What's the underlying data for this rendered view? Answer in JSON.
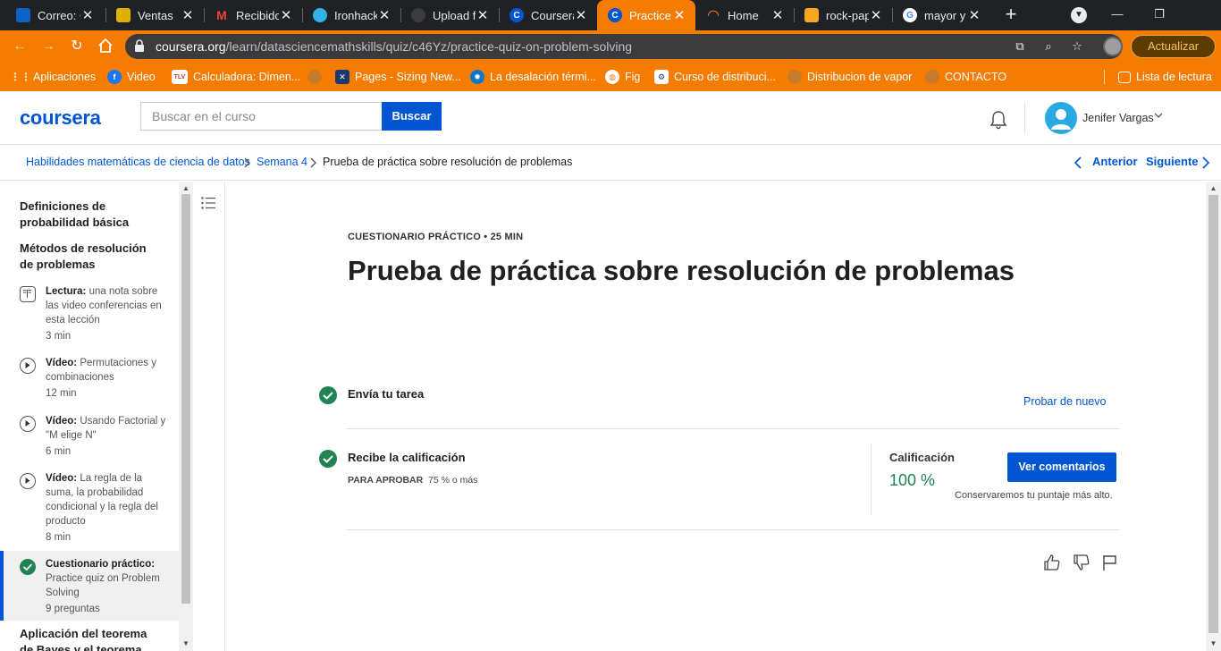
{
  "browser": {
    "tabs": [
      {
        "title": "Correo: C",
        "favicon_color": "#0a64c8",
        "favicon_glyph": "O"
      },
      {
        "title": "Ventas",
        "favicon_color": "#e0b000",
        "favicon_glyph": "V"
      },
      {
        "title": "Recibido",
        "favicon_color": "#ffffff",
        "favicon_glyph": "M"
      },
      {
        "title": "Ironhack",
        "favicon_color": "#32b2e6",
        "favicon_glyph": "I"
      },
      {
        "title": "Upload f",
        "favicon_color": "#3c3c3c",
        "favicon_glyph": "G"
      },
      {
        "title": "Coursera",
        "favicon_color": "#0056d2",
        "favicon_glyph": "C"
      },
      {
        "title": "Practice",
        "favicon_color": "#0056d2",
        "favicon_glyph": "C"
      },
      {
        "title": "Home",
        "favicon_color": "#202124",
        "favicon_glyph": "◠"
      },
      {
        "title": "rock-pap",
        "favicon_color": "#f5a623",
        "favicon_glyph": "▮"
      },
      {
        "title": "mayor y",
        "favicon_color": "#ffffff",
        "favicon_glyph": "G"
      }
    ],
    "url_host": "coursera.org",
    "url_path": "/learn/datasciencemathskills/quiz/c46Yz/practice-quiz-on-problem-solving",
    "update_label": "Actualizar",
    "bookmarks": [
      {
        "label": "Aplicaciones",
        "icon_color": "#f57c00",
        "glyph": "⋮⋮"
      },
      {
        "label": "Video",
        "icon_color": "#1877f2",
        "glyph": "f"
      },
      {
        "label": "Calculadora: Dimen...",
        "icon_color": "#c0392b",
        "glyph": "TLV"
      },
      {
        "label": "",
        "icon_color": "#c77a2a",
        "glyph": "●"
      },
      {
        "label": "Pages - Sizing New...",
        "icon_color": "#1a3a6b",
        "glyph": "✕"
      },
      {
        "label": "La desalación térmi...",
        "icon_color": "#0a78c8",
        "glyph": "✹"
      },
      {
        "label": "Fig",
        "icon_color": "#ffffff",
        "glyph": "◍"
      },
      {
        "label": "Curso de distribuci...",
        "icon_color": "#ffffff",
        "glyph": "⚙"
      },
      {
        "label": "Distribucion de vapor",
        "icon_color": "#c77a2a",
        "glyph": "●"
      },
      {
        "label": "CONTACTO",
        "icon_color": "#c77a2a",
        "glyph": "●"
      }
    ],
    "reading_list": "Lista de lectura"
  },
  "header": {
    "logo": "coursera",
    "search_placeholder": "Buscar en el curso",
    "search_button": "Buscar",
    "user_name": "Jenifer Vargas"
  },
  "breadcrumb": {
    "items": [
      "Habilidades matemáticas de ciencia de datos",
      "Semana 4",
      "Prueba de práctica sobre resolución de problemas"
    ],
    "prev": "Anterior",
    "next": "Siguiente"
  },
  "sidebar": {
    "sections": [
      "Definiciones de probabilidad básica",
      "Métodos de resolución de problemas",
      "Aplicación del teorema de Bayes y el teorema"
    ],
    "items": [
      {
        "type": "Lectura:",
        "text": "una nota sobre las video conferencias en esta lección",
        "duration": "3 min",
        "icon": "book-icon"
      },
      {
        "type": "Vídeo:",
        "text": "Permutaciones y combinaciones",
        "duration": "12 min",
        "icon": "play-icon"
      },
      {
        "type": "Vídeo:",
        "text": "Usando Factorial y \"M elige N\"",
        "duration": "6 min",
        "icon": "play-icon"
      },
      {
        "type": "Vídeo:",
        "text": "La regla de la suma, la probabilidad condicional y la regla del producto",
        "duration": "8 min",
        "icon": "play-icon"
      },
      {
        "type": "Cuestionario práctico:",
        "text": "Practice quiz on Problem Solving",
        "duration": "9 preguntas",
        "icon": "check-icon"
      }
    ]
  },
  "main": {
    "kicker": "CUESTIONARIO PRÁCTICO •  25 MIN",
    "title": "Prueba de práctica sobre resolución de problemas",
    "step1_title": "Envía tu tarea",
    "try_again": "Probar de nuevo",
    "step2_title": "Recibe la calificación",
    "pass_label": "PARA APROBAR",
    "pass_value": "75 % o más",
    "grade_label": "Calificación",
    "grade_value": "100 %",
    "feedback_button": "Ver comentarios",
    "keep_note": "Conservaremos tu puntaje más alto."
  },
  "colors": {
    "brand": "#0056d2",
    "success": "#1f8354",
    "browser_accent": "#f57c00"
  }
}
